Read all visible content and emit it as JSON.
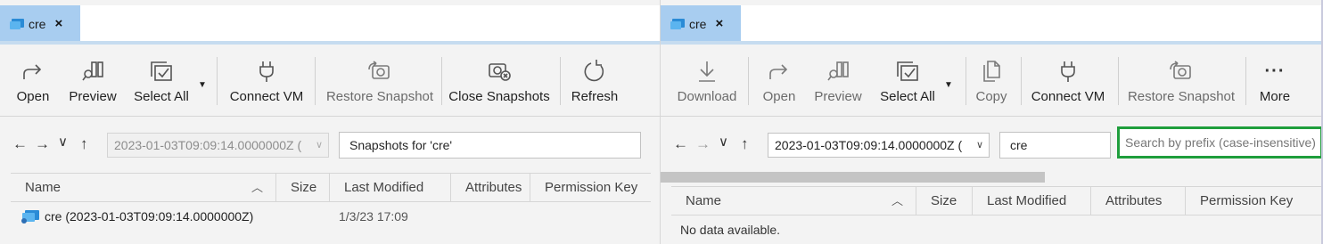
{
  "left": {
    "tab": {
      "label": "cre",
      "close": "×"
    },
    "toolbar": {
      "open": "Open",
      "preview": "Preview",
      "select_all": "Select All",
      "connect_vm": "Connect VM",
      "restore_snapshot": "Restore Snapshot",
      "close_snapshots": "Close Snapshots",
      "refresh": "Refresh"
    },
    "nav": {
      "snapshot_value": "2023-01-03T09:09:14.0000000Z (",
      "location": "Snapshots for 'cre'"
    },
    "columns": [
      "Name",
      "Size",
      "Last Modified",
      "Attributes",
      "Permission Key"
    ],
    "rows": [
      {
        "name": "cre (2023-01-03T09:09:14.0000000Z)",
        "last_modified": "1/3/23 17:09"
      }
    ]
  },
  "right": {
    "tab": {
      "label": "cre",
      "close": "×"
    },
    "toolbar": {
      "download": "Download",
      "open": "Open",
      "preview": "Preview",
      "select_all": "Select All",
      "copy": "Copy",
      "connect_vm": "Connect VM",
      "restore_snapshot": "Restore Snapshot",
      "more": "More"
    },
    "nav": {
      "snapshot_value": "2023-01-03T09:09:14.0000000Z (",
      "location": "cre",
      "search_placeholder": "Search by prefix (case-insensitive)"
    },
    "columns": [
      "Name",
      "Size",
      "Last Modified",
      "Attributes",
      "Permission Key"
    ],
    "empty_text": "No data available."
  },
  "colors": {
    "tab_active": "#a8cdf0",
    "focus_border": "#1f9e3c"
  }
}
